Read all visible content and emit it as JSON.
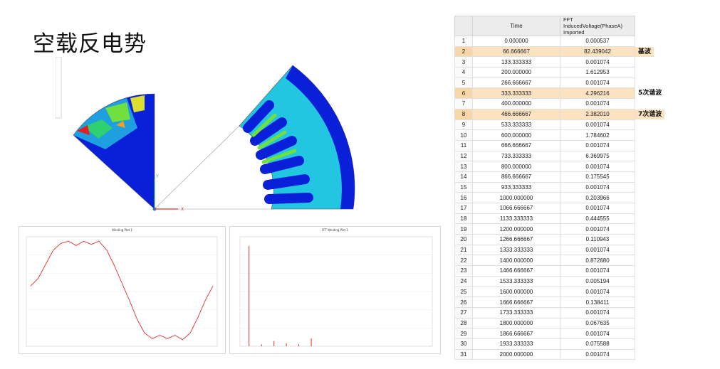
{
  "title": "空载反电势",
  "table": {
    "headers": [
      "",
      "Time",
      "FFT InducedVoltage(PhaseA) Imported"
    ],
    "rows": [
      [
        "1",
        "0.000000",
        "0.000537"
      ],
      [
        "2",
        "66.666667",
        "82.439042"
      ],
      [
        "3",
        "133.333333",
        "0.001074"
      ],
      [
        "4",
        "200.000000",
        "1.612953"
      ],
      [
        "5",
        "266.666667",
        "0.001074"
      ],
      [
        "6",
        "333.333333",
        "4.296216"
      ],
      [
        "7",
        "400.000000",
        "0.001074"
      ],
      [
        "8",
        "466.666667",
        "2.382010"
      ],
      [
        "9",
        "533.333333",
        "0.001074"
      ],
      [
        "10",
        "600.000000",
        "1.784602"
      ],
      [
        "11",
        "666.666667",
        "0.001074"
      ],
      [
        "12",
        "733.333333",
        "6.369975"
      ],
      [
        "13",
        "800.000000",
        "0.001074"
      ],
      [
        "14",
        "866.666667",
        "0.175545"
      ],
      [
        "15",
        "933.333333",
        "0.001074"
      ],
      [
        "16",
        "1000.000000",
        "0.203966"
      ],
      [
        "17",
        "1066.666667",
        "0.001074"
      ],
      [
        "18",
        "1133.333333",
        "0.444555"
      ],
      [
        "19",
        "1200.000000",
        "0.001074"
      ],
      [
        "20",
        "1266.666667",
        "0.110943"
      ],
      [
        "21",
        "1333.333333",
        "0.001074"
      ],
      [
        "22",
        "1400.000000",
        "0.872680"
      ],
      [
        "23",
        "1466.666667",
        "0.001074"
      ],
      [
        "24",
        "1533.333333",
        "0.005194"
      ],
      [
        "25",
        "1600.000000",
        "0.001074"
      ],
      [
        "26",
        "1666.666667",
        "0.138411"
      ],
      [
        "27",
        "1733.333333",
        "0.001074"
      ],
      [
        "28",
        "1800.000000",
        "0.067635"
      ],
      [
        "29",
        "1866.666667",
        "0.001074"
      ],
      [
        "30",
        "1933.333333",
        "0.075588"
      ],
      [
        "31",
        "2000.000000",
        "0.001074"
      ]
    ],
    "highlight_rows": [
      2,
      6,
      8
    ]
  },
  "notes": [
    {
      "row": 2,
      "text": "基波"
    },
    {
      "row": 6,
      "text": "5次谐波"
    },
    {
      "row": 8,
      "text": "7次谐波"
    }
  ],
  "plots": {
    "left_title": "Winding Plot 1",
    "right_title": "FFT Winding Plot 1"
  },
  "axes": {
    "x": "X",
    "y": "Y"
  },
  "chart_data": [
    {
      "type": "line",
      "title": "Winding Plot 1",
      "series": [
        {
          "values": [
            0.55,
            0.62,
            0.75,
            0.88,
            0.94,
            0.96,
            0.92,
            0.96,
            0.93,
            0.96,
            0.88,
            0.74,
            0.58,
            0.42,
            0.25,
            0.12,
            0.07,
            0.1,
            0.07,
            0.1,
            0.06,
            0.12,
            0.26,
            0.42,
            0.55
          ]
        }
      ],
      "color": "#e03030"
    },
    {
      "type": "bar",
      "title": "FFT Winding Plot 1",
      "x": [
        66.666667,
        200,
        333.333333,
        466.666667,
        600,
        733.333333
      ],
      "values": [
        82.439042,
        1.612953,
        4.296216,
        2.38201,
        1.784602,
        6.369975
      ],
      "color": "#e03030"
    }
  ],
  "colors": {
    "highlight": "#fbe3c2",
    "accent": "#e03030",
    "mesh_blue": "#0a1fd8"
  }
}
